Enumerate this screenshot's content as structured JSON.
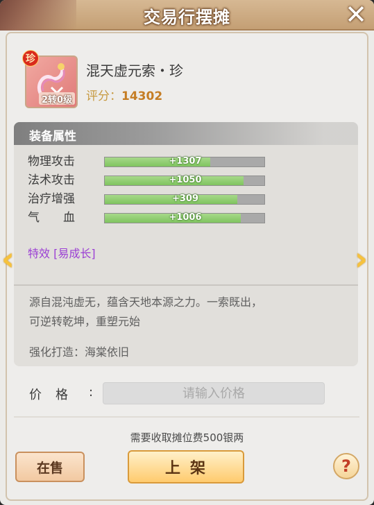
{
  "window": {
    "title": "交易行摆摊",
    "close_icon": "close-icon"
  },
  "item": {
    "name": "混天虚元索・珍",
    "badge": "珍",
    "level_tag": "2转0级",
    "score_label": "评分：",
    "score_value": "14302"
  },
  "attributes": {
    "header": "装备属性",
    "stats": [
      {
        "label": "物理攻击",
        "value": "+1307",
        "fill": 0.66
      },
      {
        "label": "法术攻击",
        "value": "+1050",
        "fill": 0.87
      },
      {
        "label": "治疗增强",
        "value": "+309",
        "fill": 0.83
      },
      {
        "label": "气　　血",
        "value": "+1006",
        "fill": 0.85
      }
    ],
    "special": "特效 [易成长]",
    "description_line1": "源自混沌虚无，蕴含天地本源之力。一索既出，",
    "description_line2": "可逆转乾坤，重塑元始",
    "forge": "强化打造：海棠依旧"
  },
  "price": {
    "label": "价格",
    "colon": ":",
    "placeholder": "请输入价格",
    "value": ""
  },
  "fee_text": "需要收取摊位费500银两",
  "buttons": {
    "on_sale": "在售",
    "list": "上架",
    "help": "?"
  },
  "colors": {
    "accent_gold": "#f6c23d",
    "special_purple": "#9b3fd4",
    "score_orange": "#c57d24"
  }
}
